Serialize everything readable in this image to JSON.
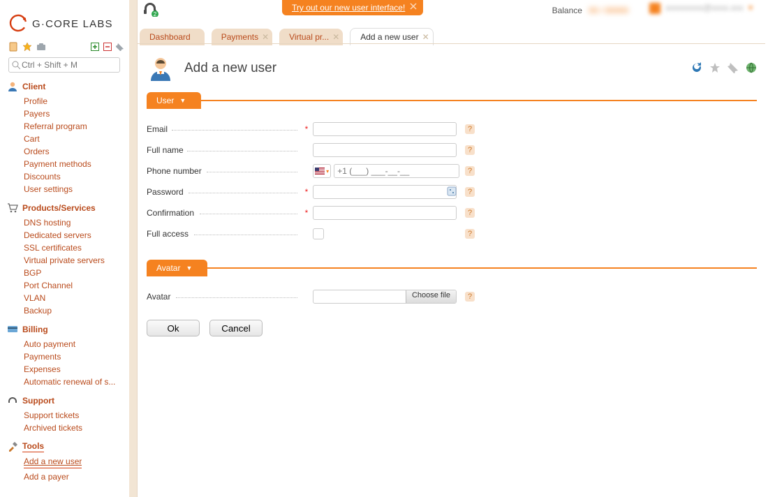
{
  "brand": "G·CORE LABS",
  "promo": {
    "text": "Try out our new user interface!"
  },
  "topbar": {
    "balance_label": "Balance",
    "balance_value": "00 / 00000"
  },
  "search": {
    "placeholder": "Ctrl + Shift + M"
  },
  "sidebar": {
    "client": {
      "title": "Client",
      "items": [
        "Profile",
        "Payers",
        "Referral program",
        "Cart",
        "Orders",
        "Payment methods",
        "Discounts",
        "User settings"
      ]
    },
    "products": {
      "title": "Products/Services",
      "items": [
        "DNS hosting",
        "Dedicated servers",
        "SSL certificates",
        "Virtual private servers",
        "BGP",
        "Port Channel",
        "VLAN",
        "Backup"
      ]
    },
    "billing": {
      "title": "Billing",
      "items": [
        "Auto payment",
        "Payments",
        "Expenses",
        "Automatic renewal of s..."
      ]
    },
    "support": {
      "title": "Support",
      "items": [
        "Support tickets",
        "Archived tickets"
      ]
    },
    "tools": {
      "title": "Tools",
      "items": [
        "Add a new user",
        "Add a payer"
      ]
    }
  },
  "tabs": [
    "Dashboard",
    "Payments",
    "Virtual pr...",
    "Add a new user"
  ],
  "page": {
    "title": "Add a new user"
  },
  "section_user": {
    "title": "User",
    "email": "Email",
    "fullname": "Full name",
    "phone": "Phone number",
    "password": "Password",
    "confirm": "Confirmation",
    "full_access": "Full access",
    "phone_mask": "+1 (___) ___-__-__"
  },
  "section_avatar": {
    "title": "Avatar",
    "avatar": "Avatar",
    "choose": "Choose file"
  },
  "buttons": {
    "ok": "Ok",
    "cancel": "Cancel"
  }
}
